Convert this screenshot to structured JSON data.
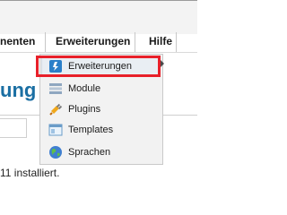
{
  "menubar": {
    "items": [
      {
        "label": "nenten"
      },
      {
        "label": "Erweiterungen"
      },
      {
        "label": "Hilfe"
      }
    ]
  },
  "page": {
    "title": "ung",
    "status": "11 installiert."
  },
  "dropdown": {
    "items": [
      {
        "label": "Erweiterungen",
        "icon": "install-icon",
        "active": true
      },
      {
        "label": "Module",
        "icon": "module-icon"
      },
      {
        "label": "Plugins",
        "icon": "plugin-icon"
      },
      {
        "label": "Templates",
        "icon": "template-icon"
      },
      {
        "label": "Sprachen",
        "icon": "globe-icon"
      }
    ]
  },
  "colors": {
    "highlight_border": "#e8202a",
    "title_blue": "#1b6fa3",
    "menu_bg": "#f3f3f3"
  }
}
